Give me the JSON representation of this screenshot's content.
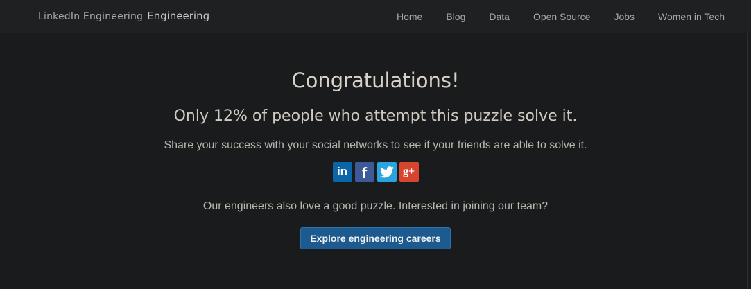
{
  "header": {
    "brand_logo": "LinkedIn Engineering",
    "brand_sub": "Engineering",
    "nav": [
      "Home",
      "Blog",
      "Data",
      "Open Source",
      "Jobs",
      "Women in Tech"
    ]
  },
  "main": {
    "heading": "Congratulations!",
    "subheading": "Only 12% of people who attempt this puzzle solve it.",
    "share_text": "Share your success with your social networks to see if your friends are able to solve it.",
    "social": [
      {
        "name": "linkedin-icon",
        "glyph": "in",
        "color": "#0a66a8"
      },
      {
        "name": "facebook-icon",
        "glyph": "f",
        "color": "#3b5a96"
      },
      {
        "name": "twitter-icon",
        "glyph": "",
        "color": "#2aa3df"
      },
      {
        "name": "google-plus-icon",
        "glyph": "g+",
        "color": "#d8452e"
      }
    ],
    "careers_text": "Our engineers also love a good puzzle. Interested in joining our team?",
    "cta_label": "Explore engineering careers"
  },
  "colors": {
    "background": "#1a1b1d",
    "navbar": "#1f2022",
    "button": "#1d5a8f"
  }
}
